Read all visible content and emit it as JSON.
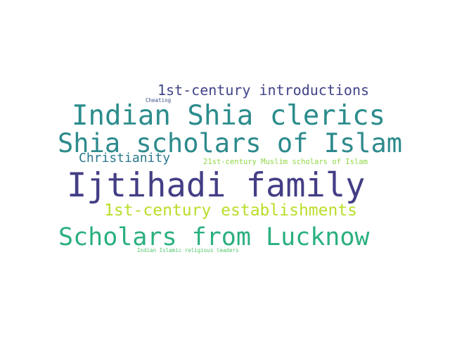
{
  "words": {
    "ijtihadi": {
      "text": "Ijtihadi family",
      "color": "#433e85"
    },
    "clerics": {
      "text": "Indian Shia clerics",
      "color": "#2c8c8c"
    },
    "scholars_islam": {
      "text": "Shia scholars of Islam",
      "color": "#2d8a8c"
    },
    "lucknow": {
      "text": "Scholars from Lucknow",
      "color": "#2ab07e"
    },
    "establishments": {
      "text": "1st-century establishments",
      "color": "#b8de29"
    },
    "introductions": {
      "text": "1st-century introductions",
      "color": "#414487"
    },
    "christianity": {
      "text": "Christianity",
      "color": "#2a788e"
    },
    "twentyfirst": {
      "text": "21st-century Muslim scholars of Islam",
      "color": "#8fd744"
    },
    "cheating": {
      "text": "Cheating",
      "color": "#3b528b"
    },
    "indian_islamic": {
      "text": "Indian Islamic religious leaders",
      "color": "#52c569"
    }
  }
}
